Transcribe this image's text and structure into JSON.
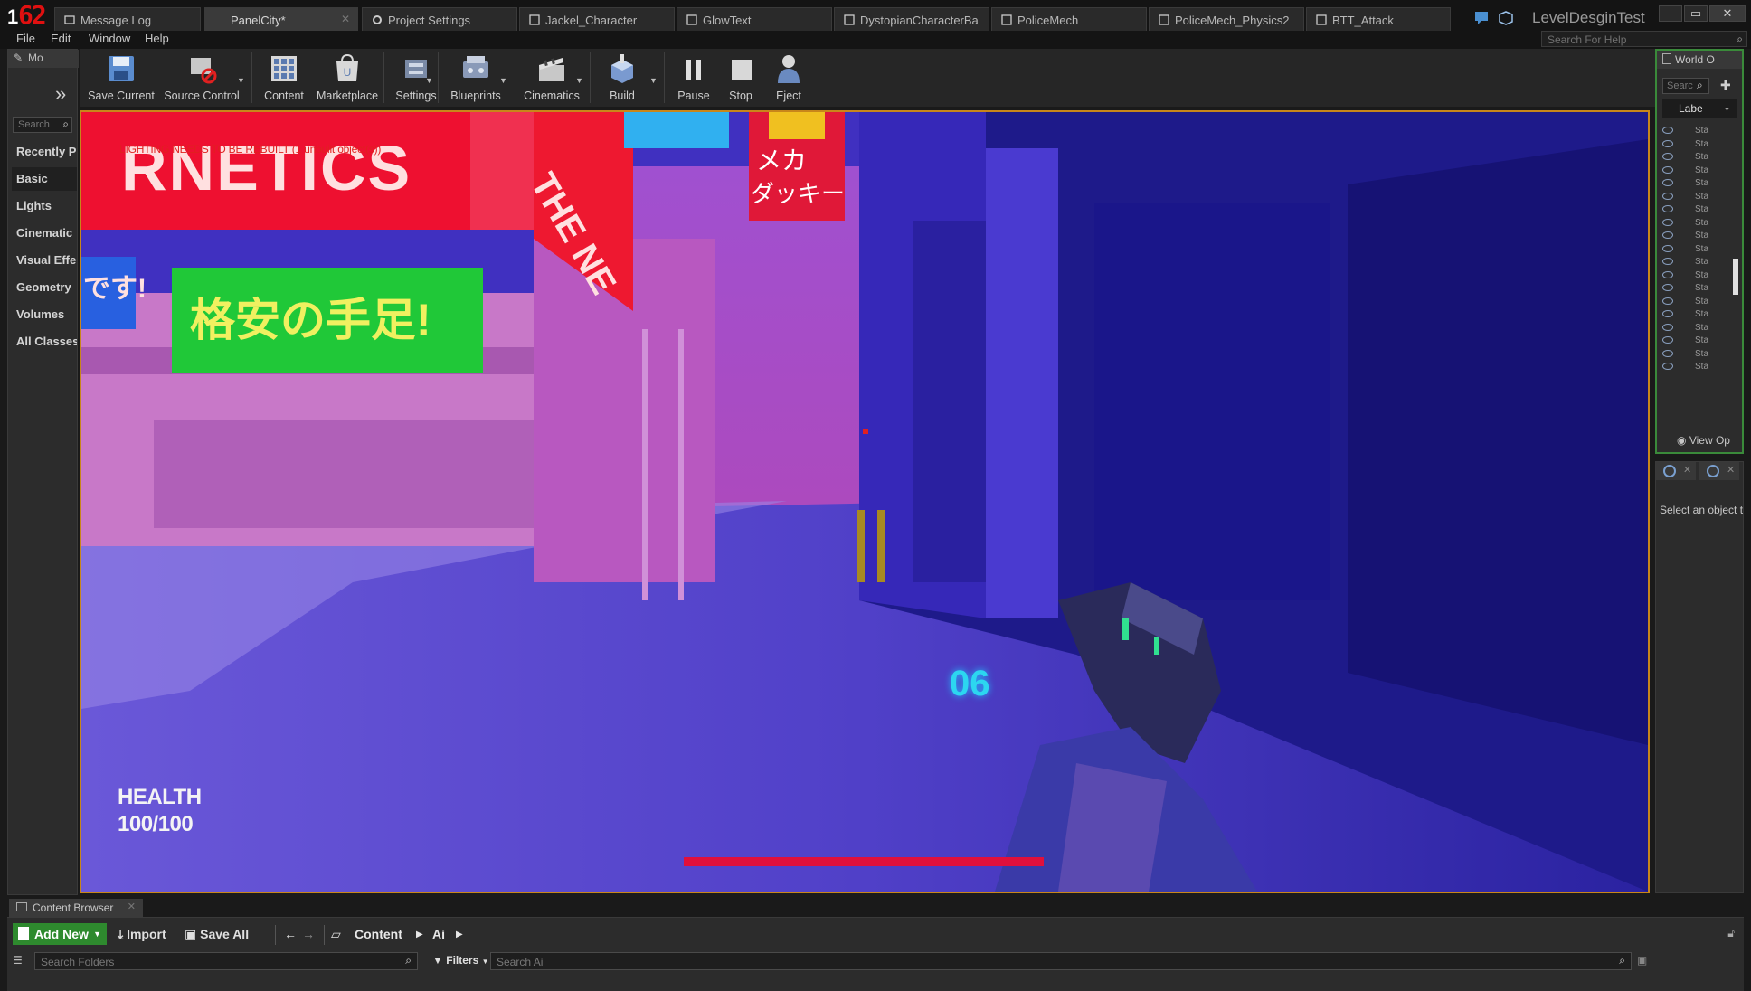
{
  "app": {
    "logo_digits": "62",
    "logo_prefix": "1",
    "project_name": "LevelDesginTest"
  },
  "tabs": [
    {
      "label": "Message Log",
      "active": false
    },
    {
      "label": "PanelCity*",
      "active": true
    },
    {
      "label": "Project Settings",
      "active": false
    },
    {
      "label": "Jackel_Character",
      "active": false
    },
    {
      "label": "GlowText",
      "active": false
    },
    {
      "label": "DystopianCharacterBa",
      "active": false
    },
    {
      "label": "PoliceMech",
      "active": false
    },
    {
      "label": "PoliceMech_Physics2",
      "active": false
    },
    {
      "label": "BTT_Attack",
      "active": false
    }
  ],
  "window_controls": {
    "minimize": "–",
    "maximize": "▭",
    "close": "✕"
  },
  "menu": [
    "File",
    "Edit",
    "Window",
    "Help"
  ],
  "help_search": {
    "placeholder": "Search For Help"
  },
  "modes": {
    "tab_label": "Mo",
    "search_placeholder": "Search",
    "categories": [
      "Recently P",
      "Basic",
      "Lights",
      "Cinematic",
      "Visual Effe",
      "Geometry",
      "Volumes",
      "All Classes"
    ],
    "selected": "Basic"
  },
  "toolbar": [
    {
      "label": "Save Current",
      "icon": "save-icon",
      "dropdown": false
    },
    {
      "label": "Source Control",
      "icon": "source-control-icon",
      "dropdown": true
    },
    {
      "label": "Content",
      "icon": "content-icon",
      "dropdown": false
    },
    {
      "label": "Marketplace",
      "icon": "marketplace-icon",
      "dropdown": false
    },
    {
      "label": "Settings",
      "icon": "settings-icon",
      "dropdown": true
    },
    {
      "label": "Blueprints",
      "icon": "blueprints-icon",
      "dropdown": true
    },
    {
      "label": "Cinematics",
      "icon": "cinematics-icon",
      "dropdown": true
    },
    {
      "label": "Build",
      "icon": "build-icon",
      "dropdown": true
    },
    {
      "label": "Pause",
      "icon": "pause-icon",
      "dropdown": false
    },
    {
      "label": "Stop",
      "icon": "stop-icon",
      "dropdown": false
    },
    {
      "label": "Eject",
      "icon": "eject-icon",
      "dropdown": false
    }
  ],
  "viewport": {
    "warning": "LIGHTING NEEDS TO BE REBUILT (1 unbuilt object(s))",
    "signs": {
      "main_sign": "RNETICS",
      "green_sign": "格安の手足!",
      "yellow_sign_top": "メカ",
      "yellow_sign_bottom": "ダッキー",
      "side_sign": "THE NE",
      "left_sign": "です!"
    },
    "hud": {
      "health_label": "HEALTH",
      "health_value": "100/100",
      "ammo": "06",
      "health_fraction": 1.0
    }
  },
  "outliner": {
    "tab_label": "World O",
    "search_placeholder": "Searc",
    "column_label": "Labe",
    "row_label": "Sta",
    "row_count": 19,
    "view_options": "View Op"
  },
  "details": {
    "hint": "Select an object t"
  },
  "content_browser": {
    "tab_label": "Content Browser",
    "add_new": "Add New",
    "import": "Import",
    "save_all": "Save All",
    "path": [
      "Content",
      "Ai"
    ],
    "folder_search_placeholder": "Search Folders",
    "filters": "Filters",
    "asset_search_placeholder": "Search Ai"
  },
  "colors": {
    "accent_orange": "#c8861a",
    "add_new_green": "#2e8a2e",
    "health_bar": "#e0103c",
    "ammo_cyan": "#2cd6f0"
  }
}
